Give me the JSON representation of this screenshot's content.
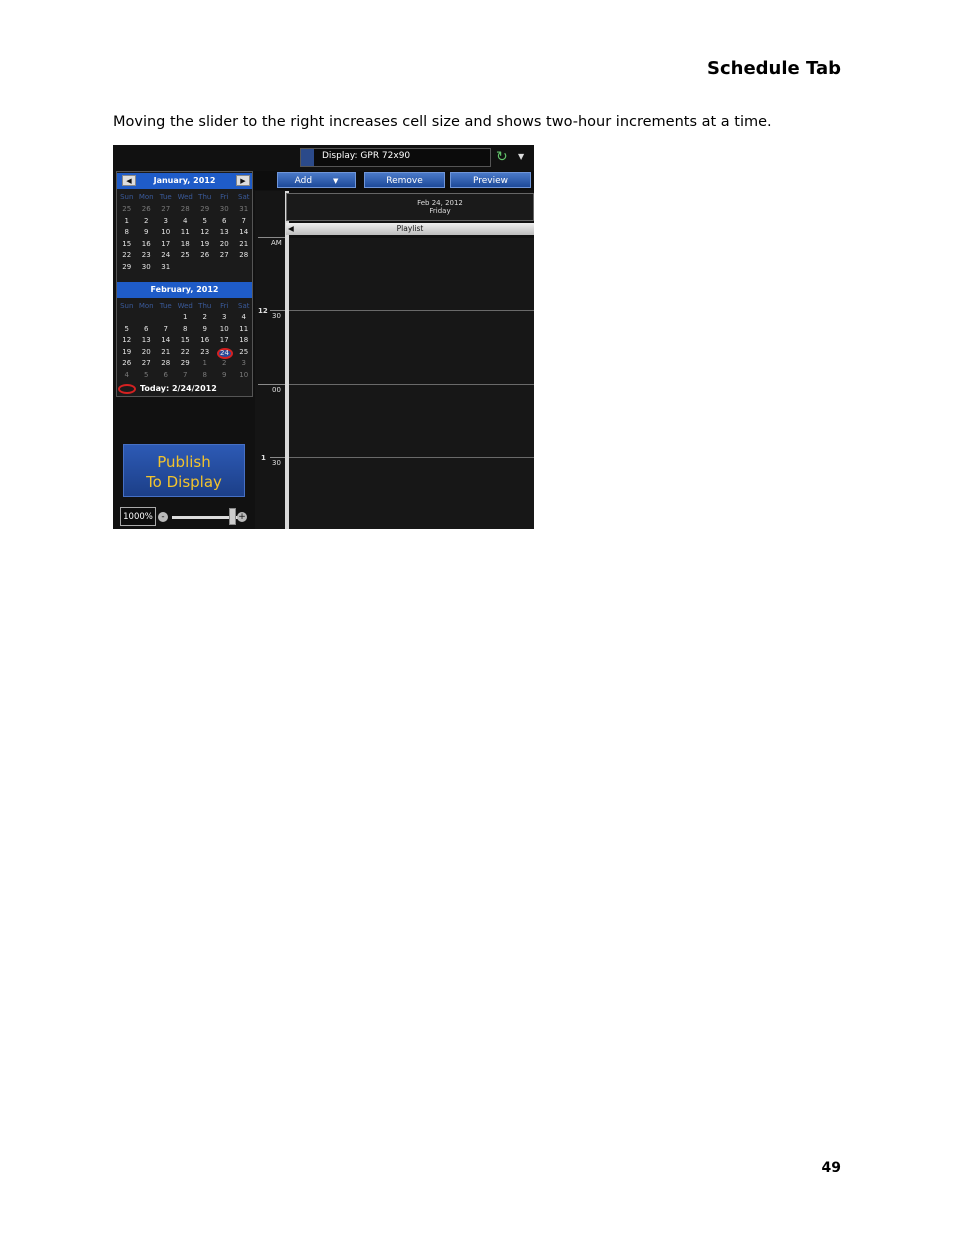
{
  "doc": {
    "header_title": "Schedule Tab",
    "intro_text": "Moving the slider to the right increases cell size and shows two-hour increments at a time.",
    "page_number": "49"
  },
  "app": {
    "display_label": "Display: GPR 72x90",
    "toolbar": {
      "add": "Add",
      "remove": "Remove",
      "preview": "Preview"
    },
    "calendar": {
      "weekday_headers": [
        "Sun",
        "Mon",
        "Tue",
        "Wed",
        "Thu",
        "Fri",
        "Sat"
      ],
      "january": {
        "title": "January, 2012",
        "weeks": [
          [
            "25",
            "26",
            "27",
            "28",
            "29",
            "30",
            "31"
          ],
          [
            "1",
            "2",
            "3",
            "4",
            "5",
            "6",
            "7"
          ],
          [
            "8",
            "9",
            "10",
            "11",
            "12",
            "13",
            "14"
          ],
          [
            "15",
            "16",
            "17",
            "18",
            "19",
            "20",
            "21"
          ],
          [
            "22",
            "23",
            "24",
            "25",
            "26",
            "27",
            "28"
          ],
          [
            "29",
            "30",
            "31",
            "",
            "",
            "",
            ""
          ]
        ]
      },
      "february": {
        "title": "February, 2012",
        "weeks": [
          [
            "",
            "",
            "",
            "1",
            "2",
            "3",
            "4"
          ],
          [
            "5",
            "6",
            "7",
            "8",
            "9",
            "10",
            "11"
          ],
          [
            "12",
            "13",
            "14",
            "15",
            "16",
            "17",
            "18"
          ],
          [
            "19",
            "20",
            "21",
            "22",
            "23",
            "24",
            "25"
          ],
          [
            "26",
            "27",
            "28",
            "29",
            "1",
            "2",
            "3"
          ],
          [
            "4",
            "5",
            "6",
            "7",
            "8",
            "9",
            "10"
          ]
        ]
      },
      "today_label": "Today: 2/24/2012"
    },
    "publish": {
      "line1": "Publish",
      "line2": "To Display"
    },
    "zoom": {
      "value": "1000%",
      "minus": "-",
      "plus": "+"
    },
    "schedule": {
      "date": "Feb 24, 2012",
      "weekday": "Friday",
      "playlist_header": "Playlist",
      "time_labels": {
        "am": "AM",
        "h12": "12",
        "m30a": "30",
        "m00": "00",
        "h1": "1",
        "m30b": "30"
      }
    }
  }
}
